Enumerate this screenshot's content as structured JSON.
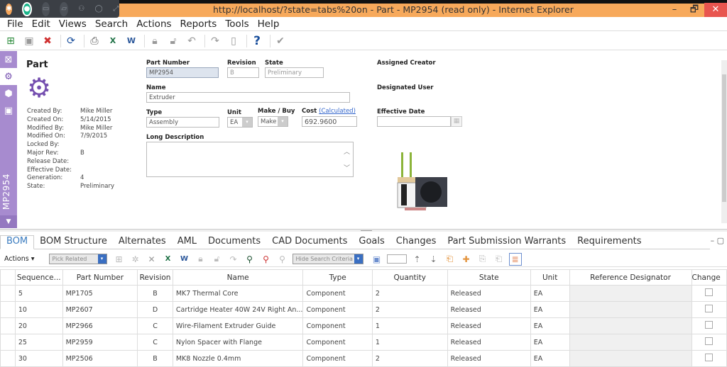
{
  "window": {
    "title": "http://localhost/?state=tabs%20on - Part - MP2954 (read only) - Internet Explorer",
    "minimize": "–",
    "maximize": "🗗",
    "close": "✕"
  },
  "overlay": {
    "icons": [
      "logo-icon",
      "microphone-icon",
      "screen-icon",
      "camera-icon",
      "participants-icon",
      "chat-icon",
      "expand-icon"
    ]
  },
  "menubar": {
    "items": [
      "File",
      "Edit",
      "Views",
      "Search",
      "Actions",
      "Reports",
      "Tools",
      "Help"
    ]
  },
  "toolbar": {
    "buttons": [
      "new",
      "save",
      "delete",
      "refresh",
      "print",
      "export-excel",
      "export-word",
      "lock",
      "unlock",
      "undo",
      "promote",
      "new-document",
      "help",
      "done"
    ]
  },
  "sidenav": {
    "vertical_label": "MP2954",
    "items": [
      "fullscreen",
      "properties",
      "3d-view",
      "image"
    ]
  },
  "part": {
    "heading": "Part",
    "properties": [
      {
        "label": "Created By:",
        "value": "Mike Miller"
      },
      {
        "label": "Created On:",
        "value": "5/14/2015"
      },
      {
        "label": "Modified By:",
        "value": "Mike Miller"
      },
      {
        "label": "Modified On:",
        "value": "7/9/2015"
      },
      {
        "label": "Locked By:",
        "value": ""
      },
      {
        "label": "Major Rev:",
        "value": "B"
      },
      {
        "label": "Release Date:",
        "value": ""
      },
      {
        "label": "Effective Date:",
        "value": ""
      },
      {
        "label": "Generation:",
        "value": "4"
      },
      {
        "label": "State:",
        "value": "Preliminary"
      }
    ]
  },
  "form": {
    "part_number": {
      "label": "Part Number",
      "value": "MP2954"
    },
    "revision": {
      "label": "Revision",
      "value": "B"
    },
    "state": {
      "label": "State",
      "value": "Preliminary"
    },
    "name": {
      "label": "Name",
      "value": "Extruder"
    },
    "type": {
      "label": "Type",
      "value": "Assembly"
    },
    "unit": {
      "label": "Unit",
      "value": "EA"
    },
    "make_buy": {
      "label": "Make / Buy",
      "value": "Make"
    },
    "cost": {
      "label": "Cost",
      "link": "(Calculated)",
      "value": "692.9600"
    },
    "long_description": {
      "label": "Long Description",
      "value": ""
    },
    "assigned_creator": {
      "label": "Assigned Creator"
    },
    "designated_user": {
      "label": "Designated User"
    },
    "effective_date": {
      "label": "Effective Date",
      "value": ""
    }
  },
  "tabs": {
    "items": [
      "BOM",
      "BOM Structure",
      "Alternates",
      "AML",
      "Documents",
      "CAD Documents",
      "Goals",
      "Changes",
      "Part Submission Warrants",
      "Requirements"
    ],
    "active": "BOM"
  },
  "bom_toolbar": {
    "actions_label": "Actions ▾",
    "pick_related": "Pick Related",
    "hide_search": "Hide Search Criteria"
  },
  "bom": {
    "columns": [
      "Sequence...",
      "Part Number",
      "Revision",
      "Name",
      "Type",
      "Quantity",
      "State",
      "Unit",
      "Reference Designator",
      "Change"
    ],
    "rows": [
      {
        "seq": "5",
        "part": "MP1705",
        "rev": "B",
        "name": "MK7 Thermal Core",
        "type": "Component",
        "qty": "2",
        "state": "Released",
        "unit": "EA",
        "ref": "",
        "change": false
      },
      {
        "seq": "10",
        "part": "MP2607",
        "rev": "D",
        "name": "Cartridge Heater 40W 24V Right An...",
        "type": "Component",
        "qty": "2",
        "state": "Released",
        "unit": "EA",
        "ref": "",
        "change": false
      },
      {
        "seq": "20",
        "part": "MP2966",
        "rev": "C",
        "name": "Wire-Filament Extruder Guide",
        "type": "Component",
        "qty": "1",
        "state": "Released",
        "unit": "EA",
        "ref": "",
        "change": false
      },
      {
        "seq": "25",
        "part": "MP2959",
        "rev": "C",
        "name": "Nylon Spacer with Flange",
        "type": "Component",
        "qty": "1",
        "state": "Released",
        "unit": "EA",
        "ref": "",
        "change": false
      },
      {
        "seq": "30",
        "part": "MP2506",
        "rev": "B",
        "name": "MK8 Nozzle 0.4mm",
        "type": "Component",
        "qty": "2",
        "state": "Released",
        "unit": "EA",
        "ref": "",
        "change": false
      }
    ]
  }
}
